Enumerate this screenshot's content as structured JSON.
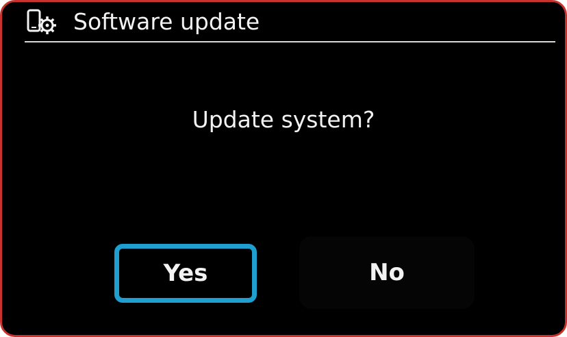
{
  "dialog": {
    "title": "Software update",
    "title_icon": "device-settings-icon",
    "prompt": "Update system?",
    "buttons": {
      "yes_label": "Yes",
      "no_label": "No",
      "focused": "yes"
    }
  },
  "colors": {
    "background": "#000000",
    "frame_border": "#c8322d",
    "focus_ring": "#1e9fd0",
    "text": "#f2f2f2",
    "divider": "#d9d9d9"
  }
}
